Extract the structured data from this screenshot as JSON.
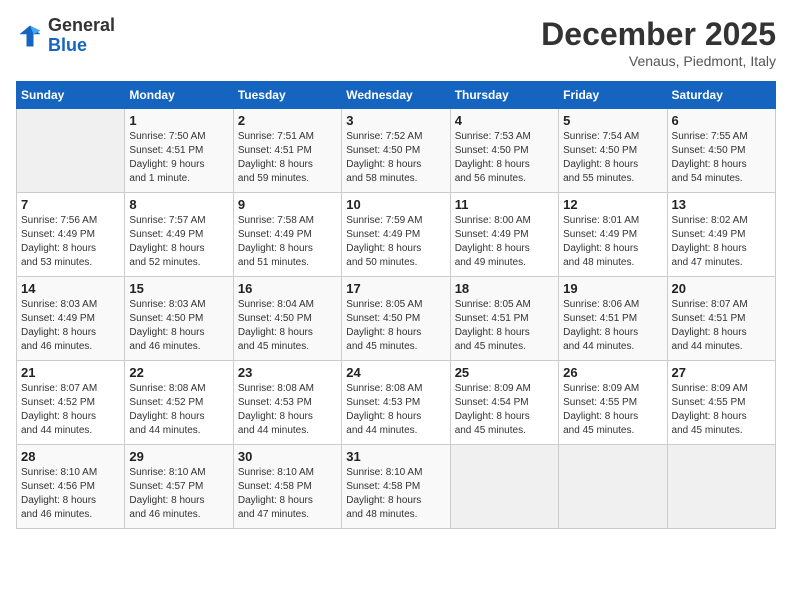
{
  "header": {
    "logo_general": "General",
    "logo_blue": "Blue",
    "month": "December 2025",
    "location": "Venaus, Piedmont, Italy"
  },
  "days_of_week": [
    "Sunday",
    "Monday",
    "Tuesday",
    "Wednesday",
    "Thursday",
    "Friday",
    "Saturday"
  ],
  "weeks": [
    [
      {
        "num": "",
        "info": ""
      },
      {
        "num": "1",
        "info": "Sunrise: 7:50 AM\nSunset: 4:51 PM\nDaylight: 9 hours\nand 1 minute."
      },
      {
        "num": "2",
        "info": "Sunrise: 7:51 AM\nSunset: 4:51 PM\nDaylight: 8 hours\nand 59 minutes."
      },
      {
        "num": "3",
        "info": "Sunrise: 7:52 AM\nSunset: 4:50 PM\nDaylight: 8 hours\nand 58 minutes."
      },
      {
        "num": "4",
        "info": "Sunrise: 7:53 AM\nSunset: 4:50 PM\nDaylight: 8 hours\nand 56 minutes."
      },
      {
        "num": "5",
        "info": "Sunrise: 7:54 AM\nSunset: 4:50 PM\nDaylight: 8 hours\nand 55 minutes."
      },
      {
        "num": "6",
        "info": "Sunrise: 7:55 AM\nSunset: 4:50 PM\nDaylight: 8 hours\nand 54 minutes."
      }
    ],
    [
      {
        "num": "7",
        "info": "Sunrise: 7:56 AM\nSunset: 4:49 PM\nDaylight: 8 hours\nand 53 minutes."
      },
      {
        "num": "8",
        "info": "Sunrise: 7:57 AM\nSunset: 4:49 PM\nDaylight: 8 hours\nand 52 minutes."
      },
      {
        "num": "9",
        "info": "Sunrise: 7:58 AM\nSunset: 4:49 PM\nDaylight: 8 hours\nand 51 minutes."
      },
      {
        "num": "10",
        "info": "Sunrise: 7:59 AM\nSunset: 4:49 PM\nDaylight: 8 hours\nand 50 minutes."
      },
      {
        "num": "11",
        "info": "Sunrise: 8:00 AM\nSunset: 4:49 PM\nDaylight: 8 hours\nand 49 minutes."
      },
      {
        "num": "12",
        "info": "Sunrise: 8:01 AM\nSunset: 4:49 PM\nDaylight: 8 hours\nand 48 minutes."
      },
      {
        "num": "13",
        "info": "Sunrise: 8:02 AM\nSunset: 4:49 PM\nDaylight: 8 hours\nand 47 minutes."
      }
    ],
    [
      {
        "num": "14",
        "info": "Sunrise: 8:03 AM\nSunset: 4:49 PM\nDaylight: 8 hours\nand 46 minutes."
      },
      {
        "num": "15",
        "info": "Sunrise: 8:03 AM\nSunset: 4:50 PM\nDaylight: 8 hours\nand 46 minutes."
      },
      {
        "num": "16",
        "info": "Sunrise: 8:04 AM\nSunset: 4:50 PM\nDaylight: 8 hours\nand 45 minutes."
      },
      {
        "num": "17",
        "info": "Sunrise: 8:05 AM\nSunset: 4:50 PM\nDaylight: 8 hours\nand 45 minutes."
      },
      {
        "num": "18",
        "info": "Sunrise: 8:05 AM\nSunset: 4:51 PM\nDaylight: 8 hours\nand 45 minutes."
      },
      {
        "num": "19",
        "info": "Sunrise: 8:06 AM\nSunset: 4:51 PM\nDaylight: 8 hours\nand 44 minutes."
      },
      {
        "num": "20",
        "info": "Sunrise: 8:07 AM\nSunset: 4:51 PM\nDaylight: 8 hours\nand 44 minutes."
      }
    ],
    [
      {
        "num": "21",
        "info": "Sunrise: 8:07 AM\nSunset: 4:52 PM\nDaylight: 8 hours\nand 44 minutes."
      },
      {
        "num": "22",
        "info": "Sunrise: 8:08 AM\nSunset: 4:52 PM\nDaylight: 8 hours\nand 44 minutes."
      },
      {
        "num": "23",
        "info": "Sunrise: 8:08 AM\nSunset: 4:53 PM\nDaylight: 8 hours\nand 44 minutes."
      },
      {
        "num": "24",
        "info": "Sunrise: 8:08 AM\nSunset: 4:53 PM\nDaylight: 8 hours\nand 44 minutes."
      },
      {
        "num": "25",
        "info": "Sunrise: 8:09 AM\nSunset: 4:54 PM\nDaylight: 8 hours\nand 45 minutes."
      },
      {
        "num": "26",
        "info": "Sunrise: 8:09 AM\nSunset: 4:55 PM\nDaylight: 8 hours\nand 45 minutes."
      },
      {
        "num": "27",
        "info": "Sunrise: 8:09 AM\nSunset: 4:55 PM\nDaylight: 8 hours\nand 45 minutes."
      }
    ],
    [
      {
        "num": "28",
        "info": "Sunrise: 8:10 AM\nSunset: 4:56 PM\nDaylight: 8 hours\nand 46 minutes."
      },
      {
        "num": "29",
        "info": "Sunrise: 8:10 AM\nSunset: 4:57 PM\nDaylight: 8 hours\nand 46 minutes."
      },
      {
        "num": "30",
        "info": "Sunrise: 8:10 AM\nSunset: 4:58 PM\nDaylight: 8 hours\nand 47 minutes."
      },
      {
        "num": "31",
        "info": "Sunrise: 8:10 AM\nSunset: 4:58 PM\nDaylight: 8 hours\nand 48 minutes."
      },
      {
        "num": "",
        "info": ""
      },
      {
        "num": "",
        "info": ""
      },
      {
        "num": "",
        "info": ""
      }
    ]
  ]
}
